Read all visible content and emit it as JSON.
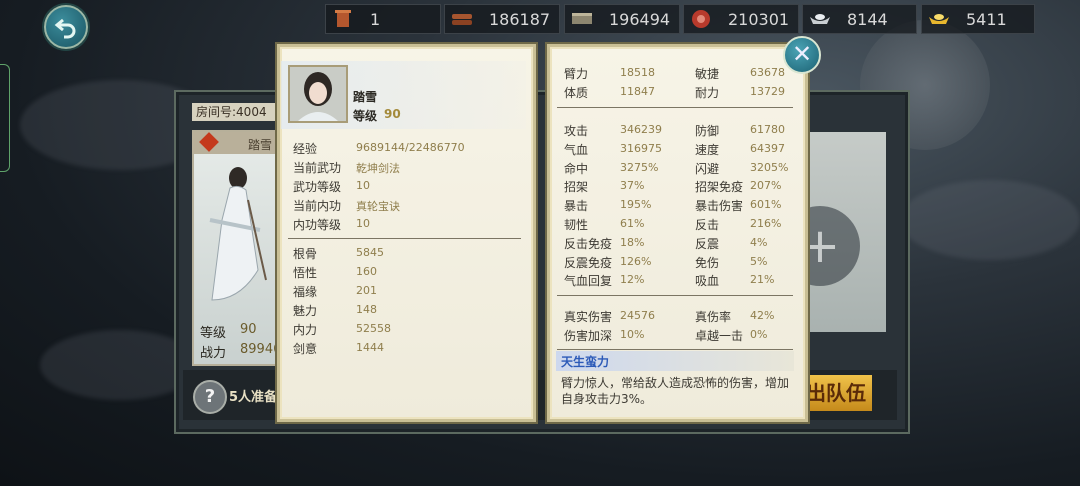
{
  "resources": [
    {
      "icon": "scroll-icon",
      "value": "1"
    },
    {
      "icon": "wood-icon",
      "value": "186187"
    },
    {
      "icon": "book-icon",
      "value": "196494"
    },
    {
      "icon": "meat-icon",
      "value": "210301"
    },
    {
      "icon": "silver-ingot-icon",
      "value": "8144"
    },
    {
      "icon": "gold-ingot-icon",
      "value": "5411"
    }
  ],
  "room": {
    "title": "房间号:4004",
    "card_name": "踏雪",
    "level_label": "等级",
    "level_value": "90",
    "power_label": "战力",
    "power_value": "89946",
    "ready_text": "5人准备",
    "leave_label": "出队伍"
  },
  "character": {
    "name": "踏雪",
    "level_label": "等级",
    "level_value": "90",
    "info": [
      {
        "label": "经验",
        "value": "9689144/22486770"
      },
      {
        "label": "当前武功",
        "value": "乾坤剑法"
      },
      {
        "label": "武功等级",
        "value": "10"
      },
      {
        "label": "当前内功",
        "value": "真轮宝诀"
      },
      {
        "label": "内功等级",
        "value": "10"
      }
    ],
    "attributes": [
      {
        "label": "根骨",
        "value": "5845"
      },
      {
        "label": "悟性",
        "value": "160"
      },
      {
        "label": "福缘",
        "value": "201"
      },
      {
        "label": "魅力",
        "value": "148"
      },
      {
        "label": "内力",
        "value": "52558"
      },
      {
        "label": "剑意",
        "value": "1444"
      }
    ]
  },
  "stats": {
    "base": [
      {
        "l1": "臂力",
        "v1": "18518",
        "l2": "敏捷",
        "v2": "63678"
      },
      {
        "l1": "体质",
        "v1": "11847",
        "l2": "耐力",
        "v2": "13729"
      }
    ],
    "combat": [
      {
        "l1": "攻击",
        "v1": "346239",
        "l2": "防御",
        "v2": "61780"
      },
      {
        "l1": "气血",
        "v1": "316975",
        "l2": "速度",
        "v2": "64397"
      },
      {
        "l1": "命中",
        "v1": "3275%",
        "l2": "闪避",
        "v2": "3205%"
      },
      {
        "l1": "招架",
        "v1": "37%",
        "l2": "招架免疫",
        "v2": "207%"
      },
      {
        "l1": "暴击",
        "v1": "195%",
        "l2": "暴击伤害",
        "v2": "601%"
      },
      {
        "l1": "韧性",
        "v1": "61%",
        "l2": "反击",
        "v2": "216%"
      },
      {
        "l1": "反击免疫",
        "v1": "18%",
        "l2": "反震",
        "v2": "4%"
      },
      {
        "l1": "反震免疫",
        "v1": "126%",
        "l2": "免伤",
        "v2": "5%"
      },
      {
        "l1": "气血回复",
        "v1": "12%",
        "l2": "吸血",
        "v2": "21%"
      }
    ],
    "extra": [
      {
        "l1": "真实伤害",
        "v1": "24576",
        "l2": "真伤率",
        "v2": "42%"
      },
      {
        "l1": "伤害加深",
        "v1": "10%",
        "l2": "卓越一击",
        "v2": "0%"
      }
    ]
  },
  "talent": {
    "title": "天生蛮力",
    "desc": "臂力惊人，常给敌人造成恐怖的伤害，增加自身攻击力3%。"
  }
}
